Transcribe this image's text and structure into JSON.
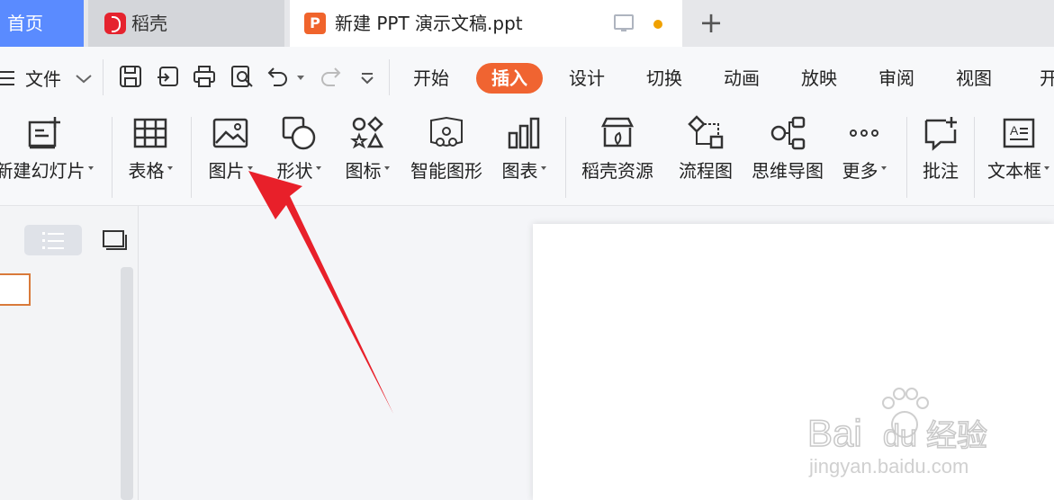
{
  "tabs": {
    "home": "首页",
    "docer": "稻壳",
    "document": "新建 PPT 演示文稿.ppt",
    "ppt_badge": "P",
    "add": "+"
  },
  "menu": {
    "file": "文件",
    "tabs": [
      "开始",
      "插入",
      "设计",
      "切换",
      "动画",
      "放映",
      "审阅",
      "视图",
      "开"
    ],
    "active_tab": "插入",
    "active_color": "#f06431"
  },
  "ribbon": {
    "new_slide": "新建幻灯片",
    "table": "表格",
    "picture": "图片",
    "shape": "形状",
    "icon": "图标",
    "smartart": "智能图形",
    "chart": "图表",
    "docer_resource": "稻壳资源",
    "flowchart": "流程图",
    "mindmap": "思维导图",
    "more": "更多",
    "comment": "批注",
    "textbox": "文本框"
  },
  "watermark": {
    "brand": "Bai",
    "brand2": "du",
    "cn": "经验",
    "url": "jingyan.baidu.com"
  },
  "annotation": {
    "arrow_color": "#e8202a",
    "target": "picture-button"
  }
}
